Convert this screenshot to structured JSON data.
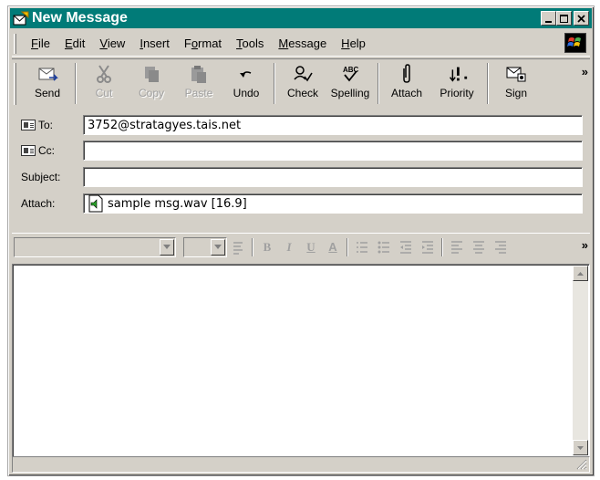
{
  "window": {
    "title": "New Message",
    "titlebar_color": "#017b78"
  },
  "menu": {
    "items": [
      {
        "pre": "",
        "u": "F",
        "post": "ile"
      },
      {
        "pre": "",
        "u": "E",
        "post": "dit"
      },
      {
        "pre": "",
        "u": "V",
        "post": "iew"
      },
      {
        "pre": "",
        "u": "I",
        "post": "nsert"
      },
      {
        "pre": "F",
        "u": "o",
        "post": "rmat"
      },
      {
        "pre": "",
        "u": "T",
        "post": "ools"
      },
      {
        "pre": "",
        "u": "M",
        "post": "essage"
      },
      {
        "pre": "",
        "u": "H",
        "post": "elp"
      }
    ]
  },
  "toolbar": {
    "send": "Send",
    "cut": "Cut",
    "copy": "Copy",
    "paste": "Paste",
    "undo": "Undo",
    "check": "Check",
    "spelling": "Spelling",
    "attach": "Attach",
    "priority": "Priority",
    "sign": "Sign",
    "more": "»"
  },
  "fields": {
    "to_label": "To:",
    "to_value": "3752@stratagyes.tais.net",
    "cc_label": "Cc:",
    "cc_value": "",
    "subject_label": "Subject:",
    "subject_value": "",
    "attach_label": "Attach:",
    "attach_value": "sample msg.wav [16.9]"
  },
  "format_toolbar": {
    "bold": "B",
    "italic": "I",
    "underline": "U",
    "font_color": "A",
    "more": "»"
  },
  "body": {
    "text": ""
  }
}
